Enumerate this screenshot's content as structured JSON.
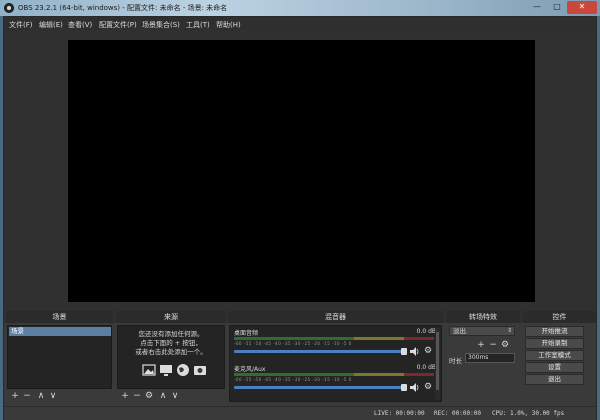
{
  "window": {
    "title": "OBS 23.2.1 (64-bit, windows) - 配置文件: 未命名 - 场景: 未命名",
    "min": "—",
    "max": "□",
    "close": "✕"
  },
  "menu": [
    "文件(F)",
    "编辑(E)",
    "查看(V)",
    "配置文件(P)",
    "场景集合(S)",
    "工具(T)",
    "帮助(H)"
  ],
  "docks": {
    "scenes": {
      "title": "场景",
      "items": [
        "场景"
      ]
    },
    "sources": {
      "title": "来源",
      "empty_line1": "您还没有添加任何源。",
      "empty_line2": "点击下面的 + 按钮，",
      "empty_line3": "或者右击此处添加一个。"
    },
    "mixer": {
      "title": "混音器",
      "tracks": [
        {
          "name": "桌面音频",
          "db": "0.0 dB"
        },
        {
          "name": "麦克风/Aux",
          "db": "0.0 dB"
        }
      ],
      "ticks": "-60 -55 -50 -45 -40 -35 -30 -25 -20 -15 -10 -5 0"
    },
    "transitions": {
      "title": "转场特效",
      "selected": "淡出",
      "duration_label": "时长",
      "duration_value": "300ms"
    },
    "controls": {
      "title": "控件",
      "buttons": [
        "开始推流",
        "开始录制",
        "工作室模式",
        "设置",
        "退出"
      ]
    }
  },
  "status": {
    "live": "LIVE: 00:00:00",
    "rec": "REC: 00:00:00",
    "cpu": "CPU: 1.0%, 30.00 fps"
  },
  "icons": {
    "add": "+",
    "remove": "−",
    "up": "∧",
    "down": "∨",
    "gear": "⚙"
  }
}
